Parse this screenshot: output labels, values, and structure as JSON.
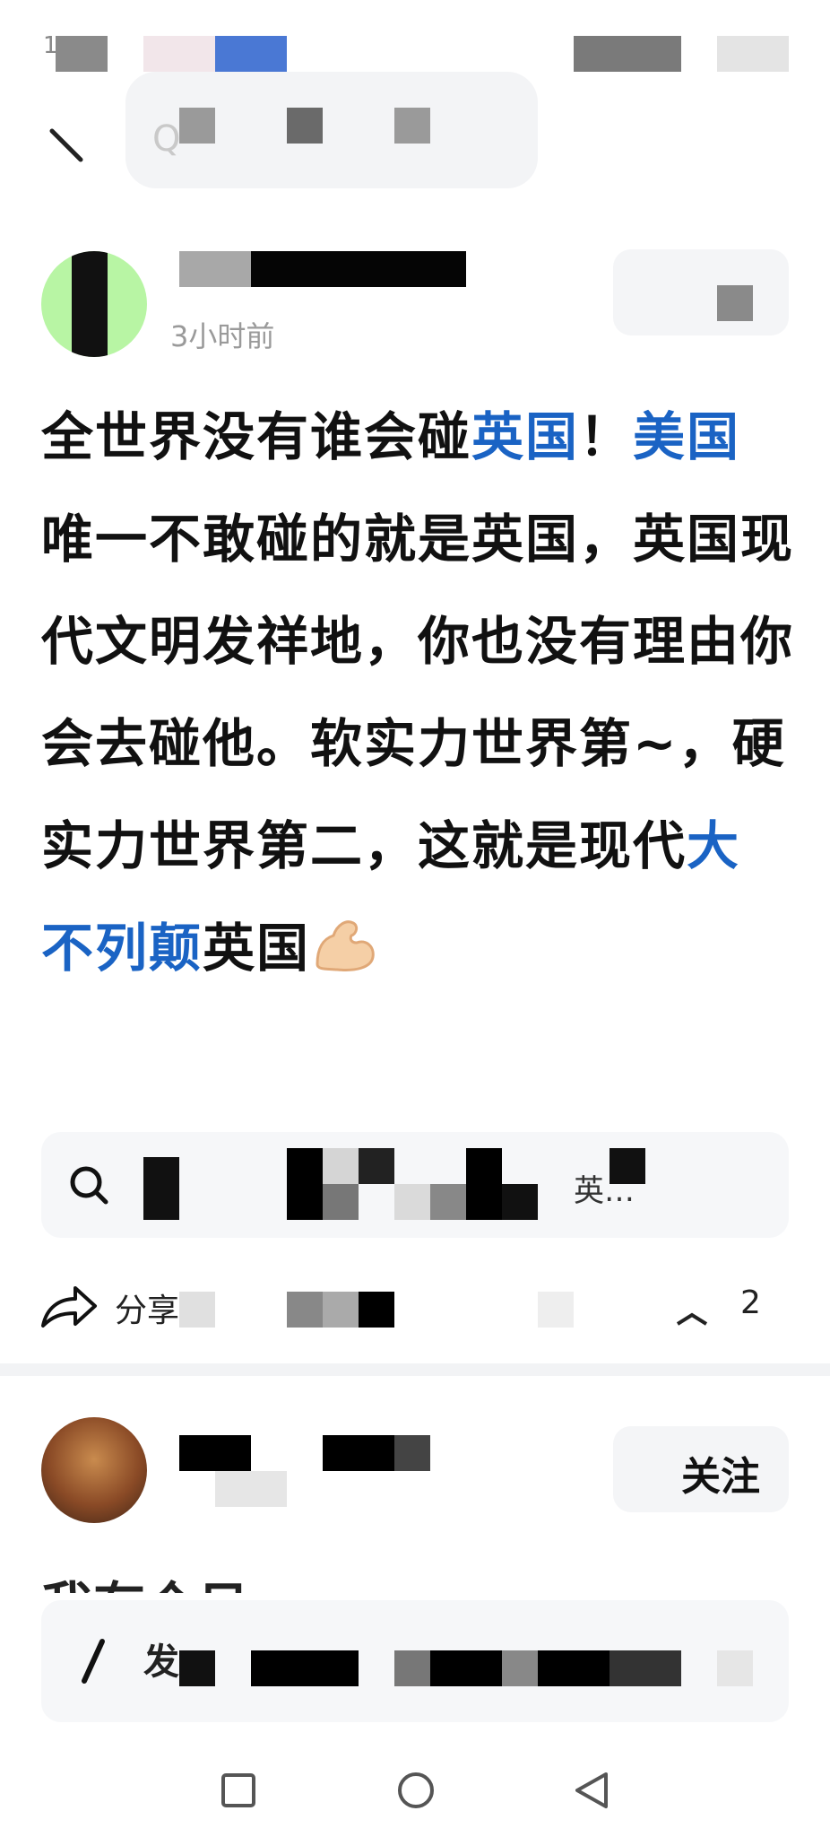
{
  "status_bar": {
    "time_partial": "1"
  },
  "header": {
    "search_prefix": "Q"
  },
  "post": {
    "time_ago": "3小时前",
    "body": [
      {
        "text": "全世界没有谁会碰",
        "link": false
      },
      {
        "text": "英国",
        "link": true
      },
      {
        "text": "！",
        "link": false
      },
      {
        "text": "美国",
        "link": true
      },
      {
        "text": "唯一不敢碰的就是英国，英国现代文明发祥地，你也没有理由你会去碰他。软实力世界第~，硬实力世界第二，这就是现代",
        "link": false
      },
      {
        "text": "大不列颠",
        "link": true
      },
      {
        "text": "英国",
        "link": false
      }
    ],
    "related_search_suffix": "英…",
    "share_label": "分享",
    "like_count": "2"
  },
  "second_post": {
    "follow_label": "关注",
    "peek_text": "我有个日"
  },
  "comment_bar": {
    "label": "发"
  },
  "colors": {
    "link": "#1a63c4",
    "text": "#111111",
    "muted": "#9a9a9a",
    "panel": "#f6f7f9"
  }
}
